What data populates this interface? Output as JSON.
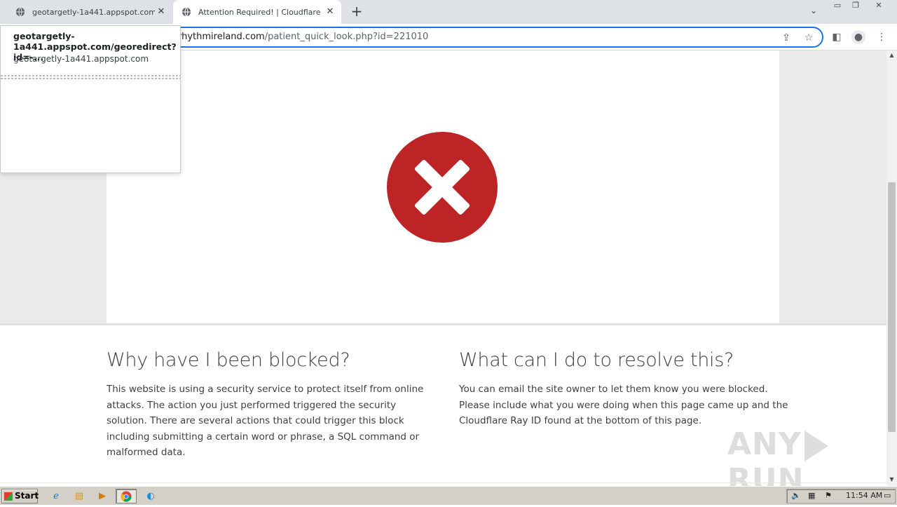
{
  "browser": {
    "tabs": [
      {
        "title": "geotargetly-1a441.appspot.com/ge",
        "icon": "globe-icon",
        "active": false
      },
      {
        "title": "Attention Required! | Cloudflare",
        "icon": "globe-icon",
        "active": true
      }
    ],
    "url": {
      "host": "rhythmireland.com",
      "path": "/patient_quick_look.php?id=221010"
    }
  },
  "hovercard": {
    "title": "geotargetly-1a441.appspot.com/georedirect?id=-...",
    "domain": "geotargetly-1a441.appspot.com"
  },
  "page": {
    "icon": "error-x-icon",
    "accent_color": "#bd2426",
    "left": {
      "heading": "Why have I been blocked?",
      "body": "This website is using a security service to protect itself from online attacks. The action you just performed triggered the security solution. There are several actions that could trigger this block including submitting a certain word or phrase, a SQL command or malformed data."
    },
    "right": {
      "heading": "What can I do to resolve this?",
      "body": "You can email the site owner to let them know you were blocked. Please include what you were doing when this page came up and the Cloudflare Ray ID found at the bottom of this page."
    }
  },
  "watermark": {
    "left": "ANY",
    "right": "RUN"
  },
  "taskbar": {
    "start_label": "Start",
    "clock": "11:54 AM"
  }
}
